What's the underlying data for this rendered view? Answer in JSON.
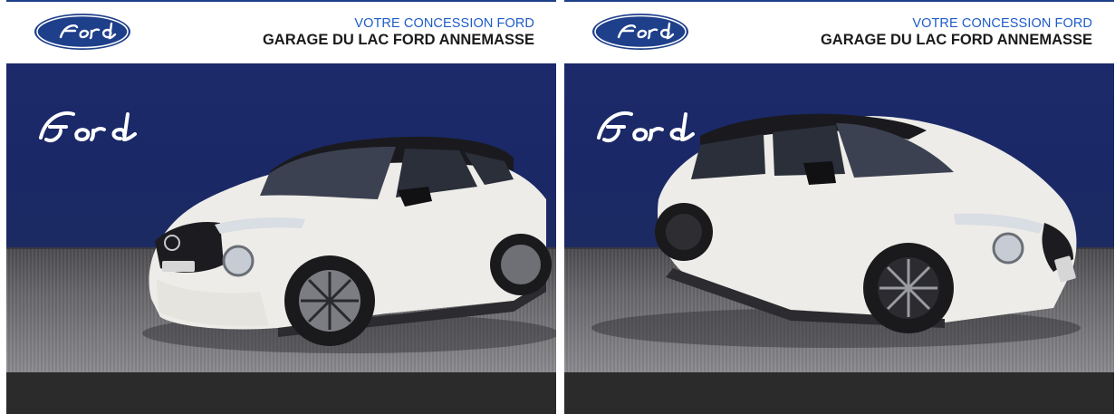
{
  "panels": [
    {
      "view": "front-left",
      "dealer_kicker": "VOTRE CONCESSION FORD",
      "dealer_name": "GARAGE DU LAC FORD ANNEMASSE"
    },
    {
      "view": "front-right",
      "dealer_kicker": "VOTRE CONCESSION FORD",
      "dealer_name": "GARAGE DU LAC FORD ANNEMASSE"
    }
  ],
  "colors": {
    "ford_blue": "#1e3f8a",
    "dealer_kicker": "#1e5cc8",
    "showroom_wall": "#1c2a6b",
    "car_body": "#eeece8",
    "car_roof": "#1a1a1e",
    "bottom_bar": "#2b2b2b"
  },
  "icons": [
    "ford-oval-logo-icon",
    "ford-script-logo-icon"
  ]
}
